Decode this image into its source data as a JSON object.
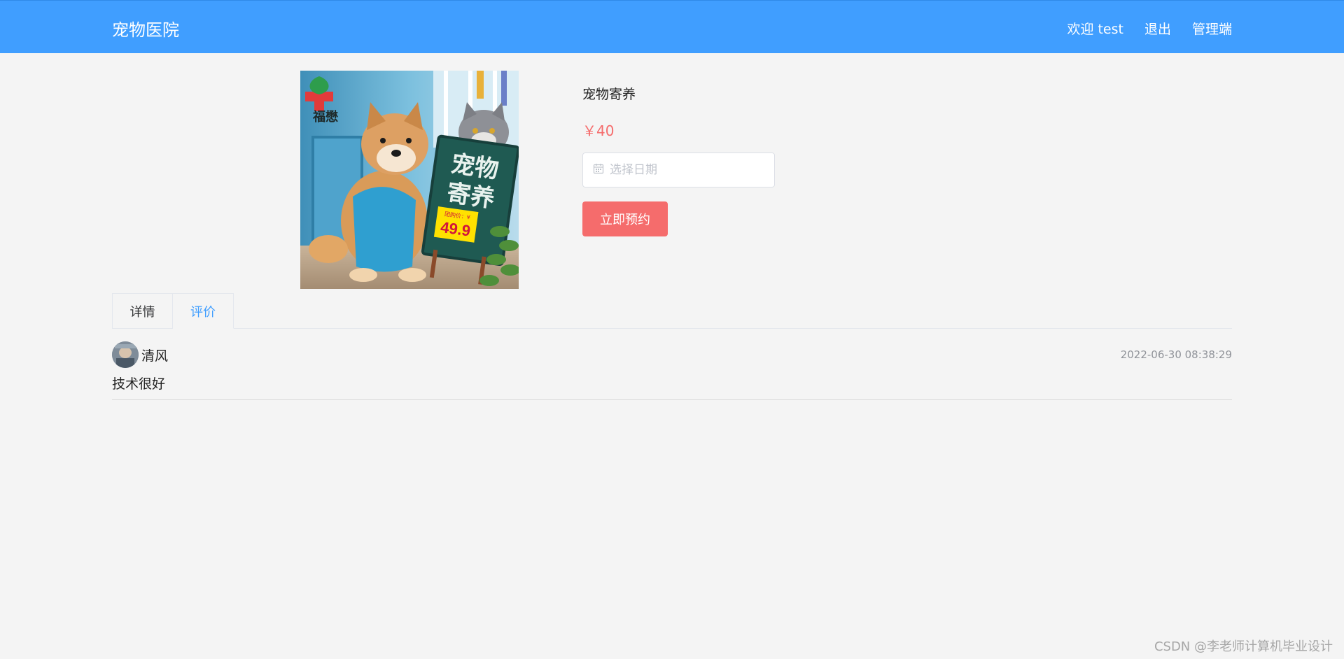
{
  "header": {
    "brand": "宠物医院",
    "nav": [
      {
        "label": "欢迎 test"
      },
      {
        "label": "退出"
      },
      {
        "label": "管理端"
      }
    ]
  },
  "product": {
    "name": "宠物寄养",
    "price": "￥40",
    "date_placeholder": "选择日期",
    "book_label": "立即预约",
    "image": {
      "logo_text": "福懋",
      "sign_line1": "宠物",
      "sign_line2": "寄养",
      "price_tag_label": "团购价：¥",
      "price_tag_value": "49.9"
    }
  },
  "tabs": [
    {
      "label": "详情",
      "active": false
    },
    {
      "label": "评价",
      "active": true
    }
  ],
  "reviews": [
    {
      "user": "清风",
      "time": "2022-06-30 08:38:29",
      "content": "技术很好"
    }
  ],
  "watermark": "CSDN @李老师计算机毕业设计",
  "colors": {
    "header": "#409eff",
    "price": "#f56c6c",
    "button": "#f56c6c",
    "active_tab": "#409eff",
    "background": "#f4f4f4"
  },
  "icons": {
    "date": "calendar-icon"
  }
}
